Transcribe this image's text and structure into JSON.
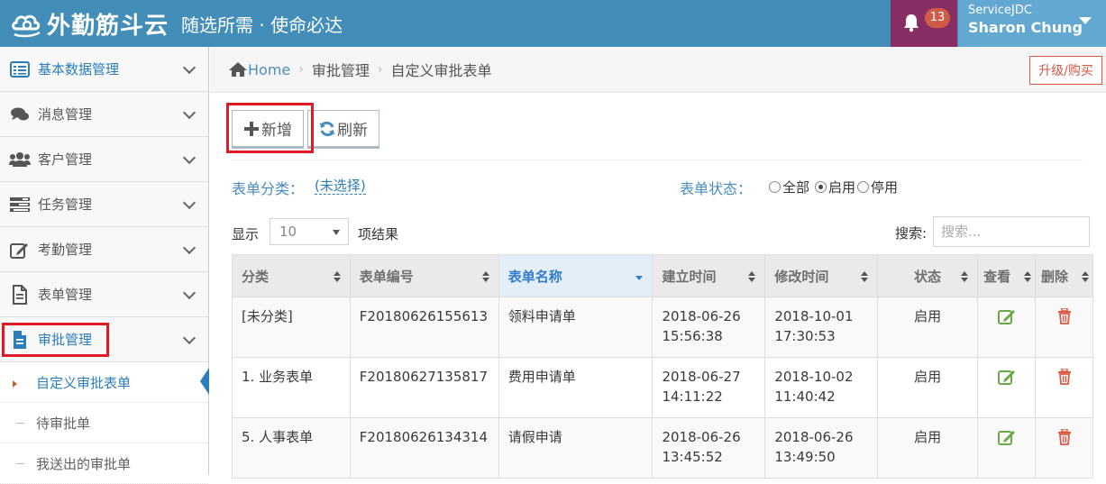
{
  "header": {
    "logo_text": "外勤筋斗云",
    "slogan": "随选所需 · 使命必达",
    "notification_count": "13",
    "user_org": "ServiceJDC",
    "user_name": "Sharon Chung",
    "colors": {
      "topbar": "#438eb9",
      "notification_bg": "#892e65",
      "user_bg": "#62a8d1",
      "badge": "#d15b47"
    }
  },
  "sidebar": {
    "items": [
      {
        "label": "基本数据管理",
        "icon": "list-icon"
      },
      {
        "label": "消息管理",
        "icon": "comments-icon"
      },
      {
        "label": "客户管理",
        "icon": "users-icon"
      },
      {
        "label": "任务管理",
        "icon": "tasks-icon"
      },
      {
        "label": "考勤管理",
        "icon": "edit-icon"
      },
      {
        "label": "表单管理",
        "icon": "file-text-icon"
      },
      {
        "label": "审批管理",
        "icon": "file-icon"
      }
    ],
    "subitems": [
      {
        "label": "自定义审批表单"
      },
      {
        "label": "待审批单"
      },
      {
        "label": "我送出的审批单"
      }
    ]
  },
  "breadcrumb": {
    "home": "Home",
    "level1": "审批管理",
    "level2": "自定义审批表单"
  },
  "upgrade_label": "升级/购买",
  "toolbar": {
    "add_label": "新增",
    "refresh_label": "刷新"
  },
  "filters": {
    "category_label": "表单分类：",
    "category_value": "(未选择)",
    "status_label": "表单状态：",
    "status_options": [
      "全部",
      "启用",
      "停用"
    ],
    "status_selected": "启用"
  },
  "length": {
    "show": "显示",
    "value": "10",
    "suffix": "项结果"
  },
  "search": {
    "label": "搜索:",
    "placeholder": "搜索..."
  },
  "table": {
    "columns": [
      "分类",
      "表单编号",
      "表单名称",
      "建立时间",
      "修改时间",
      "状态",
      "查看",
      "删除"
    ],
    "rows": [
      {
        "category": "[未分类]",
        "code": "F20180626155613",
        "name": "领料申请单",
        "created_date": "2018-06-26",
        "created_time": "15:56:38",
        "modified_date": "2018-10-01",
        "modified_time": "17:30:53",
        "status": "启用"
      },
      {
        "category": "1. 业务表单",
        "code": "F20180627135817",
        "name": "费用申请单",
        "created_date": "2018-06-27",
        "created_time": "14:11:22",
        "modified_date": "2018-10-02",
        "modified_time": "11:40:42",
        "status": "启用"
      },
      {
        "category": "5. 人事表单",
        "code": "F20180626134314",
        "name": "请假申请",
        "created_date": "2018-06-26",
        "created_time": "13:45:52",
        "modified_date": "2018-06-26",
        "modified_time": "13:49:50",
        "status": "启用"
      }
    ]
  }
}
